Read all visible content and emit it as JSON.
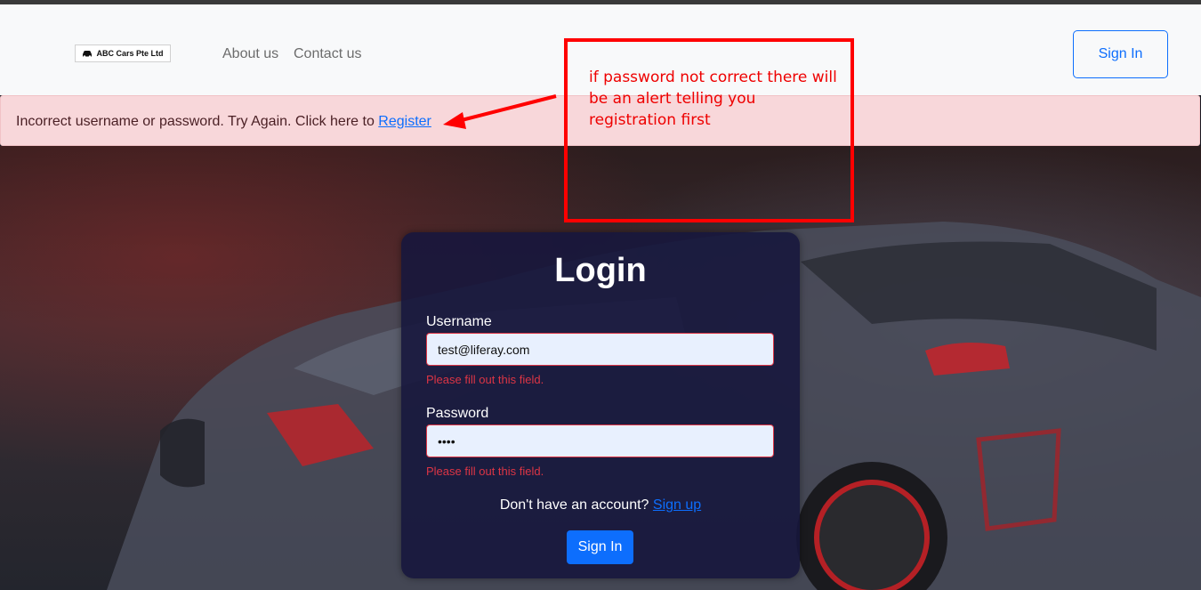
{
  "navbar": {
    "brand": "ABC Cars Pte Ltd",
    "links": [
      "About us",
      "Contact us"
    ],
    "signin_label": "Sign In"
  },
  "alert": {
    "message": "Incorrect username or password. Try Again. Click here to ",
    "link_label": "Register"
  },
  "login": {
    "title": "Login",
    "username_label": "Username",
    "username_value": "test@liferay.com",
    "username_error": "Please fill out this field.",
    "password_label": "Password",
    "password_value": "test",
    "password_error": "Please fill out this field.",
    "signup_prompt": "Don't have an account? ",
    "signup_link": "Sign up",
    "submit_label": "Sign In"
  },
  "annotation": {
    "text": "if password not correct there will be an alert telling you registration first"
  },
  "colors": {
    "primary": "#0d6efd",
    "danger": "#dc3545",
    "alert_bg": "#f8d7da",
    "annotation": "#ff0000"
  }
}
